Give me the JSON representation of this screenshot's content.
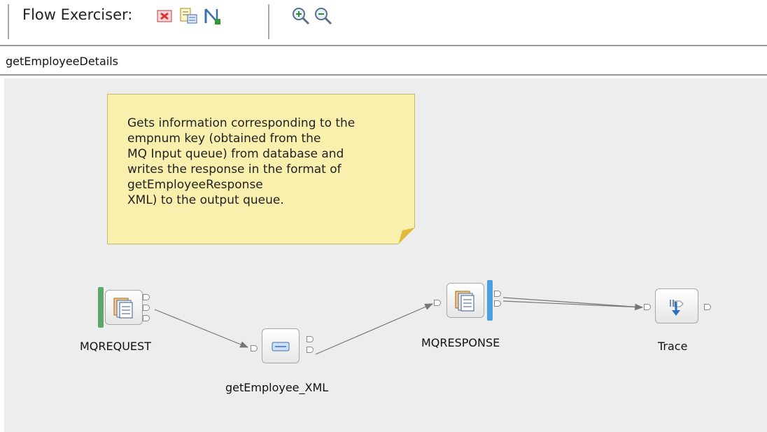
{
  "toolbar": {
    "label": "Flow Exerciser:",
    "buttons": [
      {
        "name": "stop-recording-icon",
        "color": "#d94b4b"
      },
      {
        "name": "view-recorded-message-icon",
        "color": "#3a6fb0"
      },
      {
        "name": "send-message-icon",
        "color": "#2f7d2f"
      }
    ],
    "zoom": [
      "zoom-in-icon",
      "zoom-out-icon"
    ]
  },
  "flow": {
    "name": "getEmployeeDetails"
  },
  "note": {
    "text": "Gets information corresponding to the\nempnum key (obtained from the\nMQ Input queue) from database and\nwrites the response in the format of\ngetEmployeeResponse\nXML) to the output queue."
  },
  "nodes": {
    "request": {
      "label": "MQREQUEST",
      "bar_color": "#5aa86a"
    },
    "compute": {
      "label": "getEmployee_XML"
    },
    "response": {
      "label": "MQRESPONSE",
      "bar_color": "#4a9fe0"
    },
    "trace": {
      "label": "Trace"
    }
  }
}
